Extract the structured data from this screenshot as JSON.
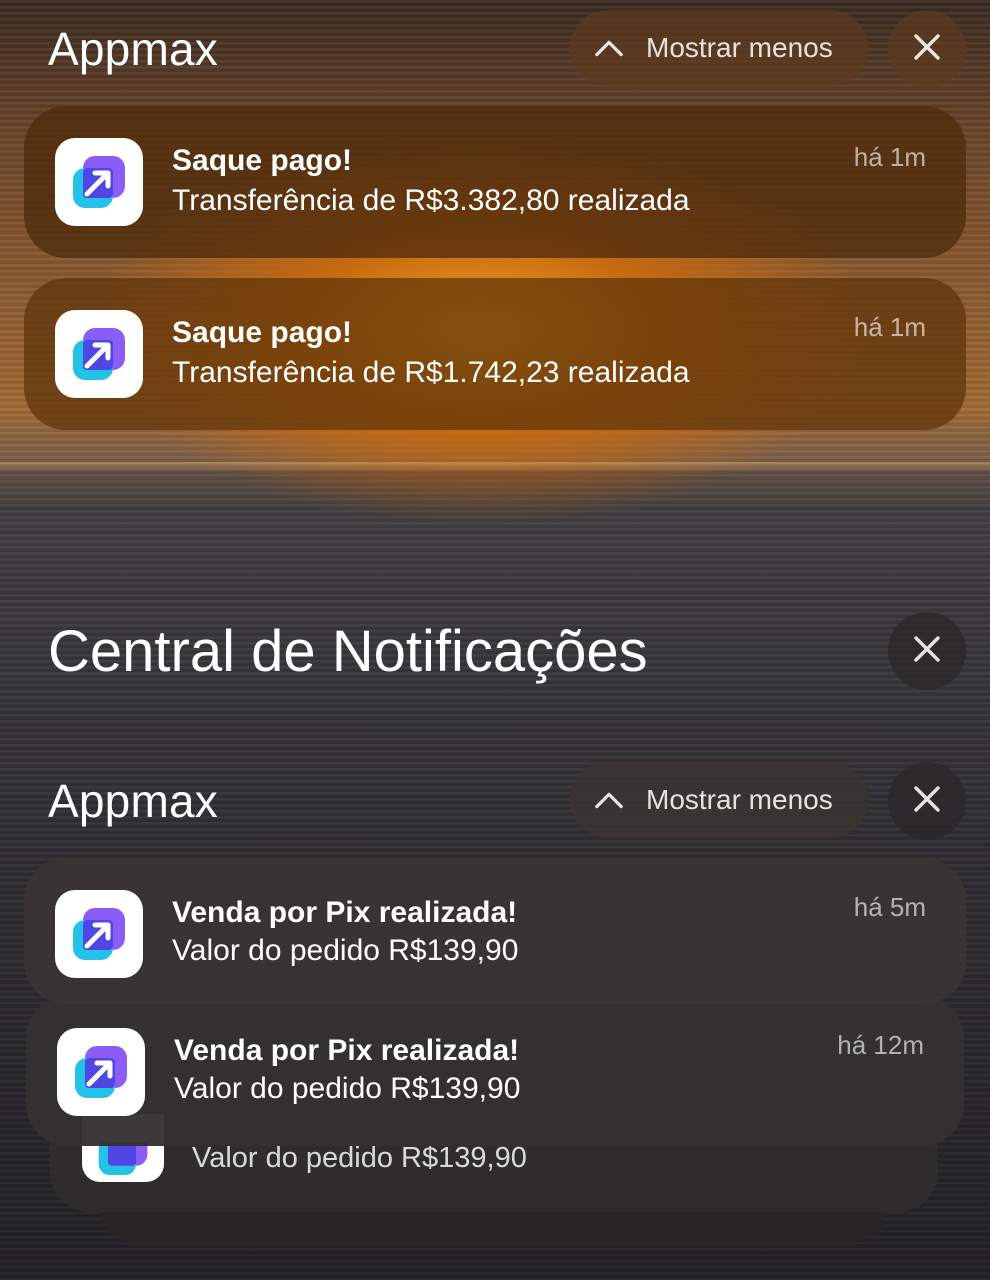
{
  "top_group": {
    "app_name": "Appmax",
    "show_less_label": "Mostrar menos",
    "notifications": [
      {
        "title": "Saque pago!",
        "body": "Transferência de R$3.382,80 realizada",
        "time": "há 1m"
      },
      {
        "title": "Saque pago!",
        "body": "Transferência de R$1.742,23 realizada",
        "time": "há 1m"
      }
    ]
  },
  "notification_center": {
    "title": "Central de Notificações"
  },
  "bottom_group": {
    "app_name": "Appmax",
    "show_less_label": "Mostrar menos",
    "notifications": [
      {
        "title": "Venda por Pix realizada!",
        "body": "Valor do pedido R$139,90",
        "time": "há 5m"
      },
      {
        "title": "Venda por Pix realizada!",
        "body": "Valor do pedido R$139,90",
        "time": "há 12m"
      },
      {
        "body": "Valor do pedido R$139,90"
      }
    ]
  },
  "icons": {
    "chevron": "chevron-up-icon",
    "close": "close-icon",
    "app": "appmax-logo-icon"
  }
}
